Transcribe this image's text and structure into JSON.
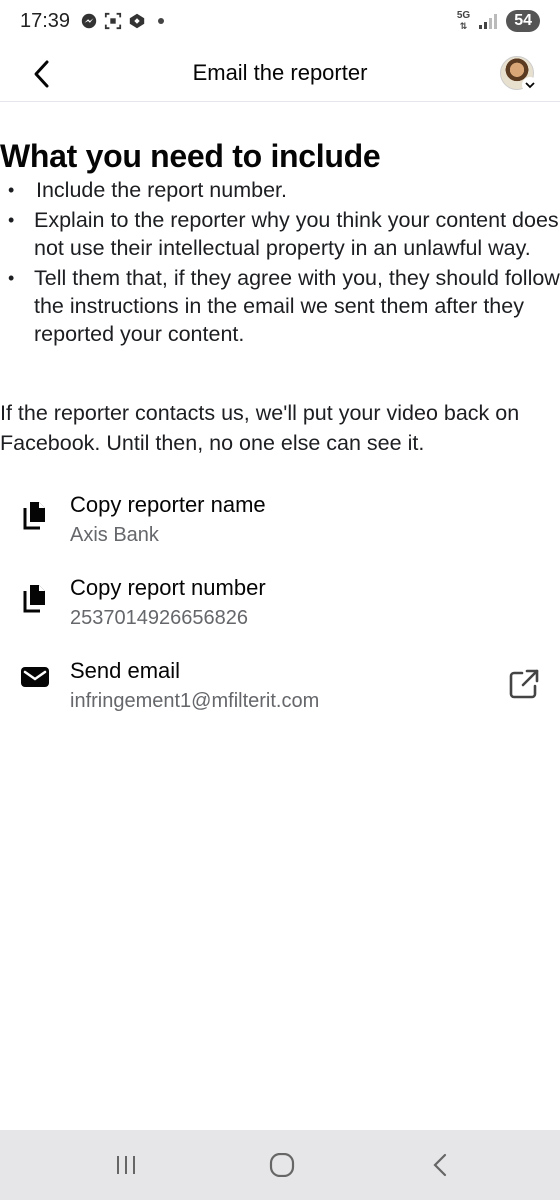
{
  "status_bar": {
    "time": "17:39",
    "network": "5G",
    "battery": "54"
  },
  "header": {
    "title": "Email the reporter"
  },
  "main": {
    "heading": "What you need to include",
    "bullets": [
      "Include the report number.",
      "Explain to the reporter why you think your content does not use their intellectual property in an unlawful way.",
      "Tell them that, if they agree with you, they should follow the instructions in the email we sent them after they reported your content."
    ],
    "paragraph": "If the reporter contacts us, we'll put your video back on Facebook. Until then, no one else can see it.",
    "actions": [
      {
        "label": "Copy reporter name",
        "value": "Axis Bank",
        "icon": "copy-icon"
      },
      {
        "label": "Copy report number",
        "value": "2537014926656826",
        "icon": "copy-icon"
      },
      {
        "label": "Send email",
        "value": "infringement1@mfilterit.com",
        "icon": "envelope-icon"
      }
    ]
  },
  "icons": {
    "back": "chevron-left-icon",
    "external": "external-link-icon",
    "nav_recents": "recents-icon",
    "nav_home": "home-icon",
    "nav_back": "back-icon"
  }
}
